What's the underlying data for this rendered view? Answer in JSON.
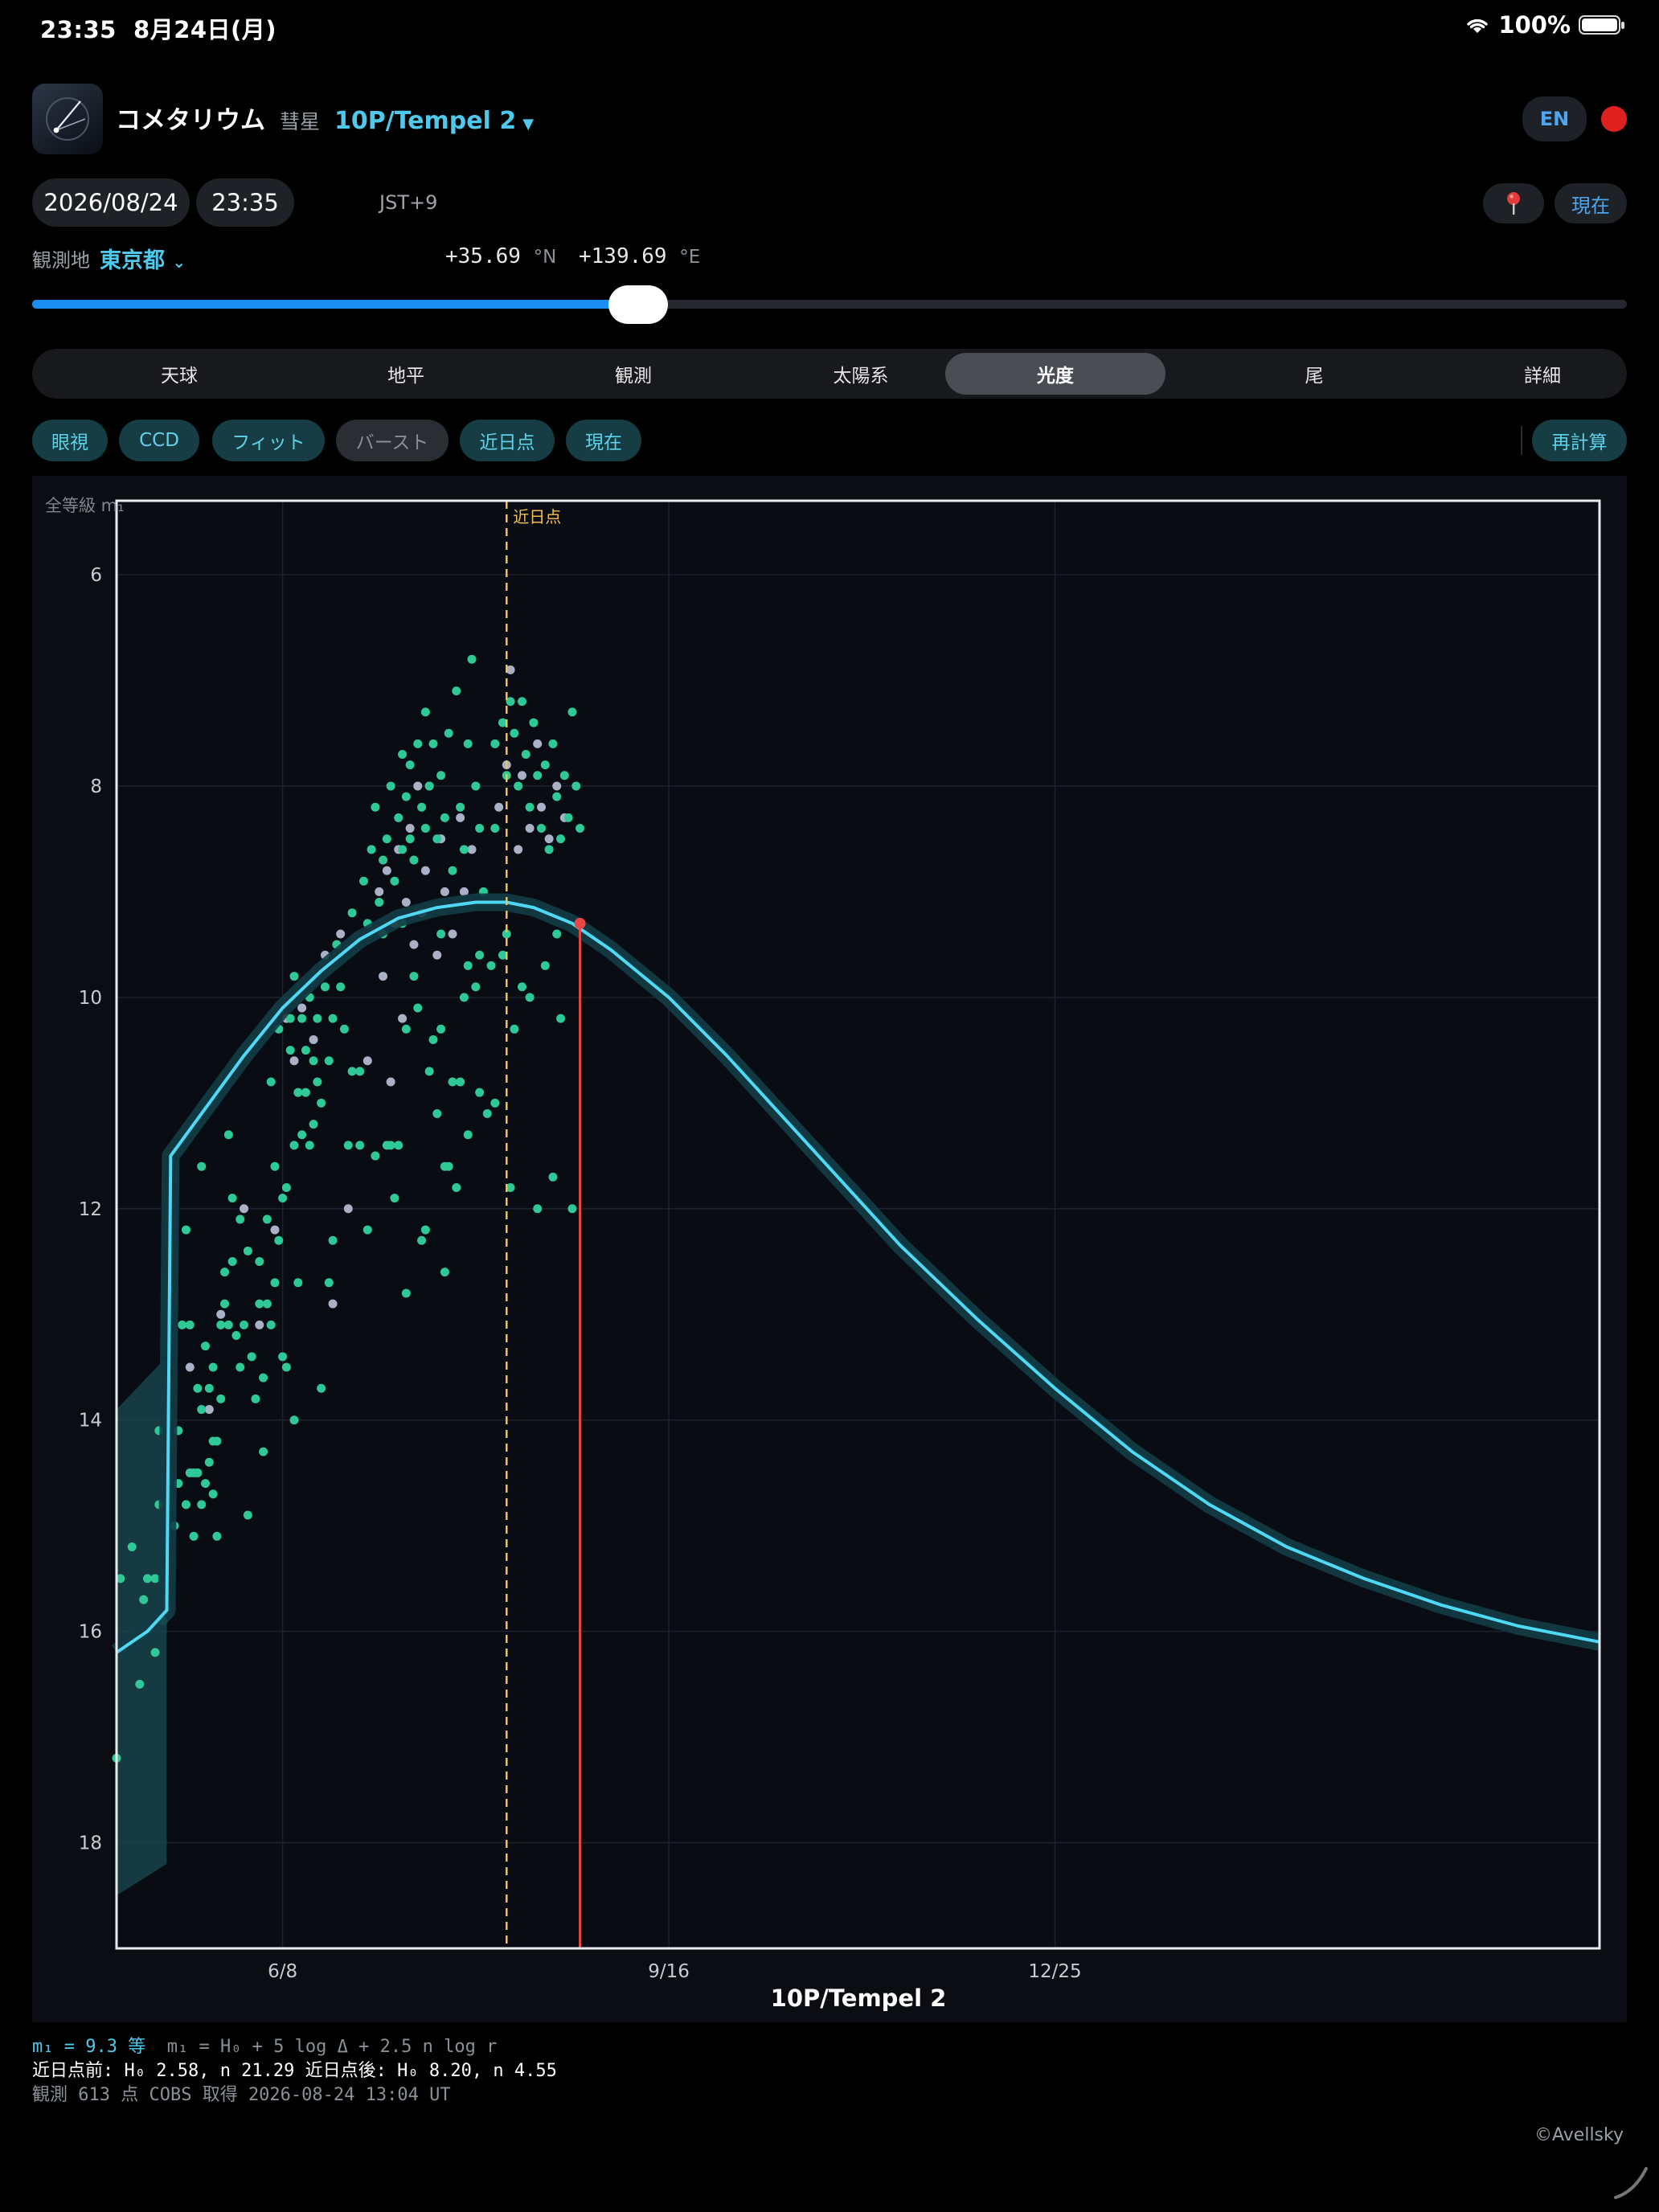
{
  "status": {
    "time": "23:35",
    "date": "8月24日(月)",
    "battery": "100%"
  },
  "header": {
    "app_title": "コメタリウム",
    "comet_label": "彗星",
    "comet_name": "10P/Tempel 2",
    "lang_button": "EN"
  },
  "datetime": {
    "date": "2026/08/24",
    "time": "23:35",
    "timezone": "JST+9",
    "now_button": "現在"
  },
  "location": {
    "label": "観測地",
    "city": "東京都",
    "lat": "+35.69",
    "lat_unit": "°N",
    "lon": "+139.69",
    "lon_unit": "°E"
  },
  "timeline": {
    "progress": 0.38
  },
  "tabs": [
    {
      "label": "天球"
    },
    {
      "label": "地平"
    },
    {
      "label": "観測"
    },
    {
      "label": "太陽系"
    },
    {
      "label": "光度",
      "active": true
    },
    {
      "label": "尾"
    },
    {
      "label": "詳細"
    }
  ],
  "chips": [
    {
      "label": "眼視",
      "on": true
    },
    {
      "label": "CCD",
      "on": true
    },
    {
      "label": "フィット",
      "on": true
    },
    {
      "label": "バースト",
      "on": false
    },
    {
      "label": "近日点",
      "on": true
    },
    {
      "label": "現在",
      "on": true
    }
  ],
  "recalc_button": "再計算",
  "chart_data": {
    "type": "scatter",
    "title": "10P/Tempel 2",
    "ylabel": "全等級 m₁",
    "y_inverted": true,
    "ylim": [
      5.3,
      19.0
    ],
    "xlim_days": [
      -43,
      341
    ],
    "x_reference_date": "2026-06-08",
    "yticks": [
      6,
      8,
      10,
      12,
      14,
      16,
      18
    ],
    "xticks": [
      {
        "label": "6/8",
        "day": 0
      },
      {
        "label": "9/16",
        "day": 100
      },
      {
        "label": "12/25",
        "day": 200
      }
    ],
    "perihelion": {
      "label": "近日点",
      "day": 58
    },
    "current": {
      "day": 77,
      "mag": 9.3
    },
    "fit_curve": [
      [
        -43,
        16.2
      ],
      [
        -35,
        16.0
      ],
      [
        -30,
        15.8
      ],
      [
        -29,
        11.5
      ],
      [
        -20,
        11.05
      ],
      [
        -10,
        10.55
      ],
      [
        0,
        10.1
      ],
      [
        10,
        9.75
      ],
      [
        20,
        9.45
      ],
      [
        30,
        9.25
      ],
      [
        40,
        9.15
      ],
      [
        50,
        9.1
      ],
      [
        58,
        9.1
      ],
      [
        65,
        9.15
      ],
      [
        75,
        9.3
      ],
      [
        85,
        9.55
      ],
      [
        100,
        10.0
      ],
      [
        115,
        10.55
      ],
      [
        130,
        11.15
      ],
      [
        145,
        11.75
      ],
      [
        160,
        12.35
      ],
      [
        180,
        13.05
      ],
      [
        200,
        13.7
      ],
      [
        220,
        14.3
      ],
      [
        240,
        14.8
      ],
      [
        260,
        15.2
      ],
      [
        280,
        15.5
      ],
      [
        300,
        15.75
      ],
      [
        320,
        15.95
      ],
      [
        341,
        16.1
      ]
    ],
    "band_pre_perihelion": {
      "upper": [
        [
          -43,
          13.9
        ],
        [
          -30,
          13.4
        ]
      ],
      "lower": [
        [
          -43,
          18.5
        ],
        [
          -30,
          18.2
        ]
      ]
    },
    "observations": {
      "count": 613,
      "visual_color": "#2fc897",
      "ccd_color": "#aab0c6",
      "visual": [
        [
          -42,
          15.5
        ],
        [
          -39,
          15.2
        ],
        [
          -37,
          16.5
        ],
        [
          -36,
          15.7
        ],
        [
          -35,
          15.5
        ],
        [
          -33,
          15.5
        ],
        [
          -33,
          16.2
        ],
        [
          -32,
          14.8
        ],
        [
          -32,
          14.1
        ],
        [
          -31,
          15.9
        ],
        [
          -43,
          17.2
        ],
        [
          -28,
          15.0
        ],
        [
          -27,
          14.6
        ],
        [
          -27,
          14.1
        ],
        [
          -26,
          13.1
        ],
        [
          -25,
          14.8
        ],
        [
          -25,
          12.2
        ],
        [
          -24,
          14.5
        ],
        [
          -24,
          13.1
        ],
        [
          -23,
          14.5
        ],
        [
          -23,
          15.1
        ],
        [
          -22,
          14.5
        ],
        [
          -22,
          13.7
        ],
        [
          -21,
          14.8
        ],
        [
          -21,
          13.9
        ],
        [
          -21,
          11.6
        ],
        [
          -20,
          14.6
        ],
        [
          -20,
          13.3
        ],
        [
          -19,
          14.4
        ],
        [
          -19,
          13.7
        ],
        [
          -18,
          14.7
        ],
        [
          -18,
          14.2
        ],
        [
          -18,
          13.5
        ],
        [
          -17,
          15.1
        ],
        [
          -17,
          14.2
        ],
        [
          -16,
          13.8
        ],
        [
          -16,
          13.1
        ],
        [
          -15,
          12.9
        ],
        [
          -15,
          12.6
        ],
        [
          -14,
          13.1
        ],
        [
          -14,
          11.3
        ],
        [
          -13,
          12.5
        ],
        [
          -13,
          11.9
        ],
        [
          -12,
          13.2
        ],
        [
          -11,
          12.1
        ],
        [
          -11,
          13.5
        ],
        [
          -10,
          13.1
        ],
        [
          -9,
          14.9
        ],
        [
          -9,
          12.4
        ],
        [
          -8,
          13.4
        ],
        [
          -7,
          13.8
        ],
        [
          -6,
          12.9
        ],
        [
          -6,
          12.5
        ],
        [
          -5,
          13.6
        ],
        [
          -5,
          14.3
        ],
        [
          -4,
          12.9
        ],
        [
          -4,
          12.1
        ],
        [
          -3,
          13.1
        ],
        [
          -3,
          10.8
        ],
        [
          -2,
          12.7
        ],
        [
          -2,
          11.6
        ],
        [
          -1,
          12.3
        ],
        [
          -1,
          10.3
        ],
        [
          0,
          13.4
        ],
        [
          0,
          11.9
        ],
        [
          1,
          13.5
        ],
        [
          1,
          11.8
        ],
        [
          2,
          10.5
        ],
        [
          2,
          10.2
        ],
        [
          3,
          11.4
        ],
        [
          3,
          14.0
        ],
        [
          3,
          9.8
        ],
        [
          4,
          12.7
        ],
        [
          4,
          10.9
        ],
        [
          5,
          11.3
        ],
        [
          5,
          10.2
        ],
        [
          6,
          10.9
        ],
        [
          6,
          10.5
        ],
        [
          7,
          11.4
        ],
        [
          7,
          10.0
        ],
        [
          8,
          11.2
        ],
        [
          8,
          10.6
        ],
        [
          9,
          10.8
        ],
        [
          9,
          10.2
        ],
        [
          10,
          13.7
        ],
        [
          10,
          11.0
        ],
        [
          11,
          9.9
        ],
        [
          12,
          10.6
        ],
        [
          12,
          12.7
        ],
        [
          13,
          12.3
        ],
        [
          13,
          10.2
        ],
        [
          14,
          9.5
        ],
        [
          15,
          9.9
        ],
        [
          16,
          10.3
        ],
        [
          17,
          11.4
        ],
        [
          18,
          9.2
        ],
        [
          18,
          10.7
        ],
        [
          20,
          11.4
        ],
        [
          20,
          10.7
        ],
        [
          22,
          12.2
        ],
        [
          24,
          11.5
        ],
        [
          26,
          9.4
        ],
        [
          27,
          11.4
        ],
        [
          28,
          11.4
        ],
        [
          29,
          11.9
        ],
        [
          30,
          11.4
        ],
        [
          31,
          9.3
        ],
        [
          32,
          12.8
        ],
        [
          32,
          10.3
        ],
        [
          33,
          8.5
        ],
        [
          34,
          9.8
        ],
        [
          35,
          10.1
        ],
        [
          36,
          12.3
        ],
        [
          37,
          12.2
        ],
        [
          38,
          10.7
        ],
        [
          39,
          10.4
        ],
        [
          40,
          11.1
        ],
        [
          41,
          10.3
        ],
        [
          41,
          9.4
        ],
        [
          42,
          11.6
        ],
        [
          42,
          12.6
        ],
        [
          43,
          11.6
        ],
        [
          44,
          10.8
        ],
        [
          45,
          11.8
        ],
        [
          46,
          10.8
        ],
        [
          47,
          10.0
        ],
        [
          48,
          11.3
        ],
        [
          48,
          9.7
        ],
        [
          50,
          9.9
        ],
        [
          51,
          10.9
        ],
        [
          51,
          9.6
        ],
        [
          53,
          11.1
        ],
        [
          54,
          9.7
        ],
        [
          55,
          11.0
        ],
        [
          55,
          8.4
        ],
        [
          57,
          9.6
        ],
        [
          58,
          9.4
        ],
        [
          59,
          11.8
        ],
        [
          60,
          10.3
        ],
        [
          62,
          9.9
        ],
        [
          64,
          10.0
        ],
        [
          66,
          12.0
        ],
        [
          68,
          9.7
        ],
        [
          70,
          11.7
        ],
        [
          71,
          9.4
        ],
        [
          72,
          10.2
        ],
        [
          75,
          12.0
        ],
        [
          21,
          8.9
        ],
        [
          22,
          9.3
        ],
        [
          23,
          8.6
        ],
        [
          24,
          8.2
        ],
        [
          25,
          9.1
        ],
        [
          26,
          8.7
        ],
        [
          27,
          8.5
        ],
        [
          28,
          8.0
        ],
        [
          29,
          8.9
        ],
        [
          30,
          8.3
        ],
        [
          31,
          8.6
        ],
        [
          31,
          7.7
        ],
        [
          32,
          8.1
        ],
        [
          33,
          7.8
        ],
        [
          34,
          8.7
        ],
        [
          35,
          7.6
        ],
        [
          36,
          8.2
        ],
        [
          37,
          8.4
        ],
        [
          37,
          7.3
        ],
        [
          38,
          8.0
        ],
        [
          39,
          7.6
        ],
        [
          40,
          8.5
        ],
        [
          41,
          7.9
        ],
        [
          42,
          8.3
        ],
        [
          43,
          7.5
        ],
        [
          44,
          8.8
        ],
        [
          45,
          7.1
        ],
        [
          46,
          8.2
        ],
        [
          47,
          8.6
        ],
        [
          48,
          7.6
        ],
        [
          49,
          6.8
        ],
        [
          50,
          8.0
        ],
        [
          51,
          8.4
        ],
        [
          52,
          9.0
        ],
        [
          55,
          7.6
        ],
        [
          57,
          7.4
        ],
        [
          58,
          7.9
        ],
        [
          59,
          7.2
        ],
        [
          60,
          7.5
        ],
        [
          61,
          8.0
        ],
        [
          62,
          7.2
        ],
        [
          63,
          7.7
        ],
        [
          64,
          8.2
        ],
        [
          65,
          7.4
        ],
        [
          66,
          7.9
        ],
        [
          67,
          8.4
        ],
        [
          68,
          7.8
        ],
        [
          69,
          8.6
        ],
        [
          70,
          7.6
        ],
        [
          71,
          8.1
        ],
        [
          72,
          8.5
        ],
        [
          73,
          7.9
        ],
        [
          74,
          8.3
        ],
        [
          75,
          7.3
        ],
        [
          76,
          8.0
        ],
        [
          77,
          8.4
        ]
      ],
      "ccd": [
        [
          -24,
          13.5
        ],
        [
          -19,
          13.9
        ],
        [
          -16,
          13.0
        ],
        [
          -10,
          12.0
        ],
        [
          -6,
          13.1
        ],
        [
          -2,
          12.2
        ],
        [
          1,
          10.2
        ],
        [
          3,
          10.6
        ],
        [
          5,
          10.1
        ],
        [
          8,
          10.4
        ],
        [
          11,
          9.6
        ],
        [
          13,
          12.9
        ],
        [
          15,
          9.4
        ],
        [
          17,
          12.0
        ],
        [
          22,
          10.6
        ],
        [
          25,
          9.0
        ],
        [
          26,
          9.8
        ],
        [
          27,
          8.8
        ],
        [
          28,
          10.8
        ],
        [
          29,
          9.3
        ],
        [
          30,
          8.6
        ],
        [
          31,
          10.2
        ],
        [
          32,
          9.1
        ],
        [
          33,
          8.4
        ],
        [
          34,
          9.5
        ],
        [
          35,
          8.0
        ],
        [
          36,
          9.2
        ],
        [
          37,
          8.8
        ],
        [
          38,
          8.0
        ],
        [
          40,
          9.6
        ],
        [
          41,
          8.5
        ],
        [
          42,
          9.0
        ],
        [
          44,
          9.4
        ],
        [
          46,
          8.3
        ],
        [
          47,
          9.0
        ],
        [
          49,
          8.6
        ],
        [
          56,
          8.2
        ],
        [
          58,
          7.8
        ],
        [
          59,
          6.9
        ],
        [
          61,
          8.6
        ],
        [
          62,
          7.9
        ],
        [
          64,
          8.4
        ],
        [
          66,
          7.6
        ],
        [
          67,
          8.2
        ],
        [
          69,
          8.5
        ],
        [
          71,
          8.0
        ],
        [
          73,
          8.3
        ]
      ]
    }
  },
  "footer": {
    "mag_line": "m₁ = 9.3 等",
    "formula": "m₁ = H₀ + 5 log Δ + 2.5 n log r",
    "params": "近日点前: H₀ 2.58, n 21.29  近日点後: H₀ 8.20, n 4.55",
    "source": "観測 613 点  COBS 取得 2026-08-24 13:04 UT"
  },
  "credit": "©Avellsky",
  "colors": {
    "accent": "#4ec9ec",
    "fit": "#4fd8f4",
    "perihelion": "#f2c14e",
    "current": "#e84545"
  }
}
